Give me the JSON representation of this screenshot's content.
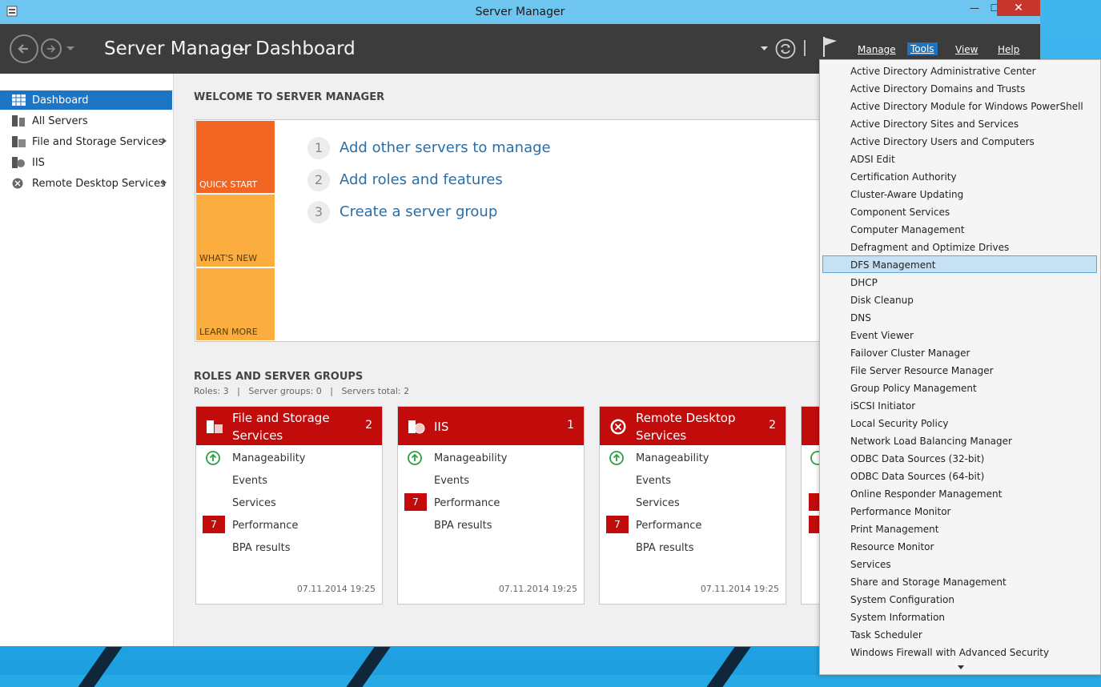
{
  "window": {
    "title": "Server Manager",
    "close": "✕",
    "minimize": "—",
    "maximize": "☐"
  },
  "header": {
    "app": "Server Manager",
    "separator": "▸",
    "page": "Dashboard",
    "menus": [
      "Manage",
      "Tools",
      "View",
      "Help"
    ],
    "active_menu": "Tools"
  },
  "sidebar": {
    "items": [
      {
        "label": "Dashboard",
        "icon": "dashboard-icon",
        "selected": true,
        "has_arrow": false
      },
      {
        "label": "All Servers",
        "icon": "all-servers-icon",
        "selected": false,
        "has_arrow": false
      },
      {
        "label": "File and Storage Services",
        "icon": "file-storage-icon",
        "selected": false,
        "has_arrow": true
      },
      {
        "label": "IIS",
        "icon": "iis-icon",
        "selected": false,
        "has_arrow": false
      },
      {
        "label": "Remote Desktop Services",
        "icon": "remote-desktop-icon",
        "selected": false,
        "has_arrow": true
      }
    ]
  },
  "welcome": {
    "heading": "WELCOME TO SERVER MANAGER",
    "tiles": [
      "QUICK START",
      "WHAT'S NEW",
      "LEARN MORE"
    ],
    "steps": [
      {
        "num": "1",
        "text": "Add other servers to manage"
      },
      {
        "num": "2",
        "text": "Add roles and features"
      },
      {
        "num": "3",
        "text": "Create a server group"
      }
    ]
  },
  "roles": {
    "heading": "ROLES AND SERVER GROUPS",
    "summary": "Roles: 3   |   Server groups: 0   |   Servers total: 2",
    "cards": [
      {
        "title_line1": "File and Storage",
        "title_line2": "Services",
        "count": "2",
        "manageability": "Manageability",
        "events": "Events",
        "services": "Services",
        "performance": "Performance",
        "performance_badge": "7",
        "bpa": "BPA results",
        "date": "07.11.2014 19:25"
      },
      {
        "title_line1": "IIS",
        "title_line2": "",
        "count": "1",
        "manageability": "Manageability",
        "events": "Events",
        "services": "",
        "performance": "Performance",
        "performance_badge": "7",
        "bpa": "BPA results",
        "date": "07.11.2014 19:25"
      },
      {
        "title_line1": "Remote Desktop",
        "title_line2": "Services",
        "count": "2",
        "manageability": "Manageability",
        "events": "Events",
        "services": "Services",
        "performance": "Performance",
        "performance_badge": "7",
        "bpa": "BPA results",
        "date": "07.11.2014 19:25"
      }
    ]
  },
  "tools_menu": {
    "highlighted": "DFS Management",
    "items": [
      "Active Directory Administrative Center",
      "Active Directory Domains and Trusts",
      "Active Directory Module for Windows PowerShell",
      "Active Directory Sites and Services",
      "Active Directory Users and Computers",
      "ADSI Edit",
      "Certification Authority",
      "Cluster-Aware Updating",
      "Component Services",
      "Computer Management",
      "Defragment and Optimize Drives",
      "DFS Management",
      "DHCP",
      "Disk Cleanup",
      "DNS",
      "Event Viewer",
      "Failover Cluster Manager",
      "File Server Resource Manager",
      "Group Policy Management",
      "iSCSI Initiator",
      "Local Security Policy",
      "Network Load Balancing Manager",
      "ODBC Data Sources (32-bit)",
      "ODBC Data Sources (64-bit)",
      "Online Responder Management",
      "Performance Monitor",
      "Print Management",
      "Resource Monitor",
      "Services",
      "Share and Storage Management",
      "System Configuration",
      "System Information",
      "Task Scheduler",
      "Windows Firewall with Advanced Security"
    ]
  },
  "colors": {
    "accent": "#1c76c5",
    "role_red": "#c20c0c",
    "quick_start": "#f26522",
    "whats_new": "#fbad3f",
    "link": "#2a6ea8"
  }
}
